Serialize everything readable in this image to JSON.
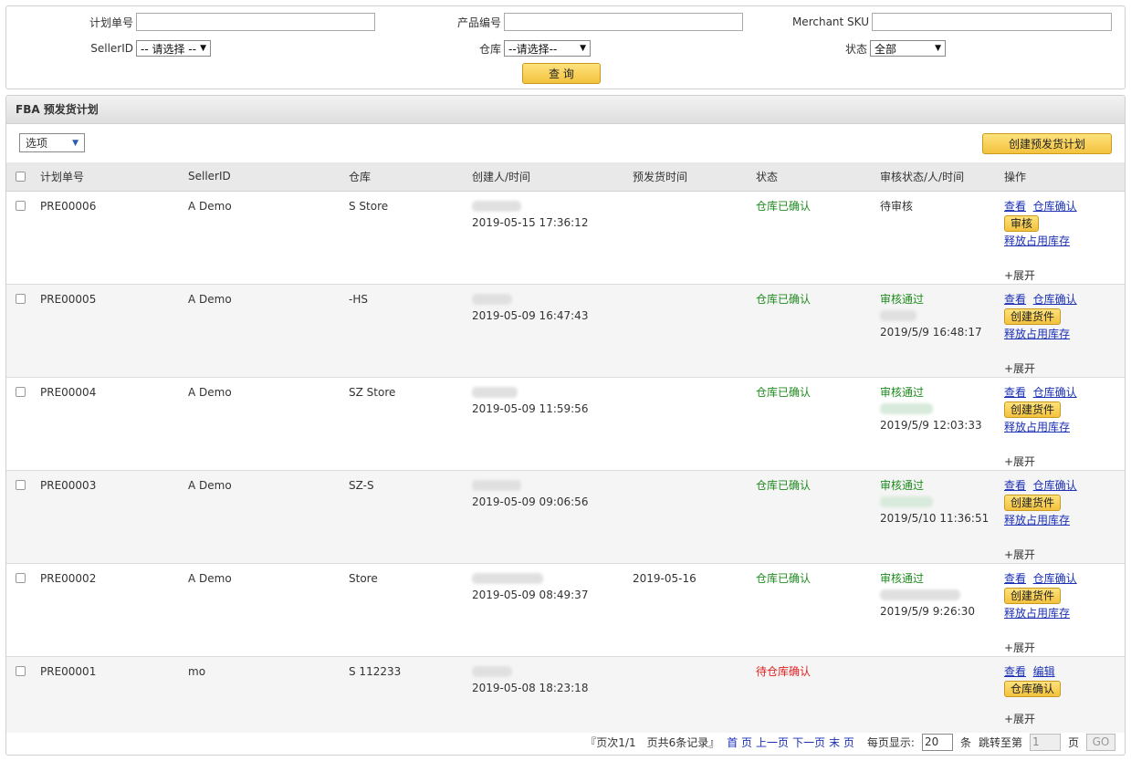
{
  "filters": {
    "plan_no_label": "计划单号",
    "product_no_label": "产品编号",
    "merchant_sku_label": "Merchant SKU",
    "seller_id_label": "SellerID",
    "seller_id_value": "-- 请选择 --",
    "warehouse_label": "仓库",
    "warehouse_value": "--请选择--",
    "status_label": "状态",
    "status_value": "全部",
    "query_label": "查 询"
  },
  "panel": {
    "title": "FBA 预发货计划",
    "options_label": "选项",
    "create_label": "创建预发货计划"
  },
  "columns": [
    "计划单号",
    "SellerID",
    "仓库",
    "创建人/时间",
    "预发货时间",
    "状态",
    "审核状态/人/时间",
    "操作"
  ],
  "rows": [
    {
      "plan": "PRE00006",
      "seller": "A   Demo",
      "warehouse": "S  Store",
      "created_at": "2019-05-15 17:36:12",
      "ship_date": "",
      "status": "仓库已确认",
      "review_status": "待审核",
      "review_time": "",
      "actions": [
        "查看",
        "仓库确认"
      ],
      "button": "审核",
      "release": "释放占用库存",
      "expand": "+展开"
    },
    {
      "plan": "PRE00005",
      "seller": "A   Demo",
      "warehouse": "  -HS",
      "created_at": "2019-05-09 16:47:43",
      "ship_date": "",
      "status": "仓库已确认",
      "review_status": "审核通过",
      "review_time": "2019/5/9 16:48:17",
      "actions": [
        "查看",
        "仓库确认"
      ],
      "button": "创建货件",
      "release": "释放占用库存",
      "expand": "+展开"
    },
    {
      "plan": "PRE00004",
      "seller": "A   Demo",
      "warehouse": "SZ Store",
      "created_at": "2019-05-09 11:59:56",
      "ship_date": "",
      "status": "仓库已确认",
      "review_status": "审核通过",
      "review_time": "2019/5/9 12:03:33",
      "actions": [
        "查看",
        "仓库确认"
      ],
      "button": "创建货件",
      "release": "释放占用库存",
      "expand": "+展开"
    },
    {
      "plan": "PRE00003",
      "seller": "A   Demo",
      "warehouse": "SZ-S",
      "created_at": "2019-05-09 09:06:56",
      "ship_date": "",
      "status": "仓库已确认",
      "review_status": "审核通过",
      "review_time": "2019/5/10 11:36:51",
      "actions": [
        "查看",
        "仓库确认"
      ],
      "button": "创建货件",
      "release": "释放占用库存",
      "expand": "+展开"
    },
    {
      "plan": "PRE00002",
      "seller": "A   Demo",
      "warehouse": "  Store",
      "created_at": "2019-05-09 08:49:37",
      "ship_date": "2019-05-16",
      "status": "仓库已确认",
      "review_status": "审核通过",
      "review_time": "2019/5/9 9:26:30",
      "actions": [
        "查看",
        "仓库确认"
      ],
      "button": "创建货件",
      "release": "释放占用库存",
      "expand": "+展开"
    },
    {
      "plan": "PRE00001",
      "seller": "    mo",
      "warehouse": "S  112233",
      "created_at": "2019-05-08 18:23:18",
      "ship_date": "",
      "status": "待仓库确认",
      "review_status": "",
      "review_time": "",
      "actions": [
        "查看",
        "编辑"
      ],
      "button": "仓库确认",
      "release": "",
      "expand": "+展开"
    }
  ],
  "pager": {
    "summary": "『页次1/1　页共6条记录』",
    "first": "首 页",
    "prev": "上一页",
    "next": "下一页",
    "last": "末 页",
    "per_page_label": "每页显示:",
    "per_page_value": "20",
    "per_page_unit": "条",
    "jump_label": "跳转至第",
    "jump_value": "1",
    "jump_unit": "页",
    "go": "GO"
  }
}
